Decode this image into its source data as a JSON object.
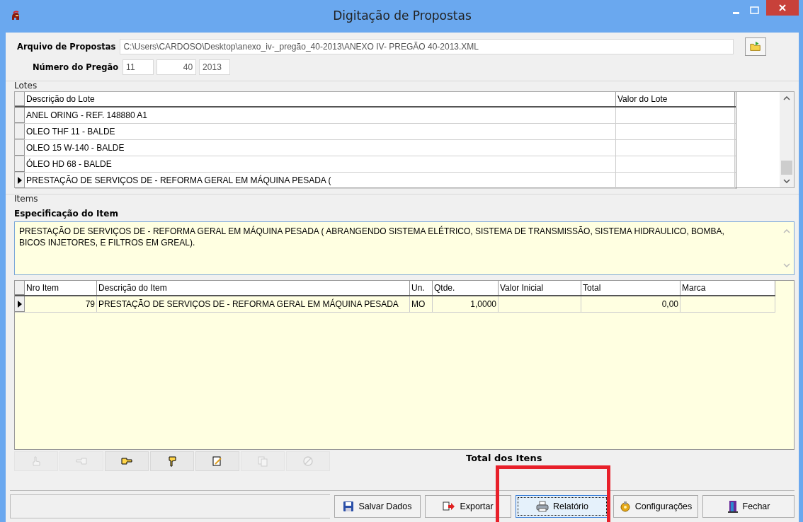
{
  "window": {
    "title": "Digitação de Propostas"
  },
  "file": {
    "label": "Arquivo de Propostas",
    "value": "C:\\Users\\CARDOSO\\Desktop\\anexo_iv-_pregão_40-2013\\ANEXO IV- PREGÃO 40-2013.XML"
  },
  "pregao": {
    "label": "Número do Pregão",
    "values": [
      "11",
      "40",
      "2013"
    ]
  },
  "lotes": {
    "title": "Lotes",
    "columns": [
      "Descrição do Lote",
      "Valor do Lote"
    ],
    "rows": [
      {
        "descricao": "ANEL ORING - REF. 148880 A1",
        "selected": false
      },
      {
        "descricao": "OLEO THF 11 - BALDE",
        "selected": false
      },
      {
        "descricao": "OLEO 15 W-140 - BALDE",
        "selected": false
      },
      {
        "descricao": "ÓLEO HD 68 - BALDE",
        "selected": false
      },
      {
        "descricao": "PRESTAÇÃO DE SERVIÇOS DE - REFORMA GERAL EM MÁQUINA PESADA (",
        "selected": true
      }
    ]
  },
  "items": {
    "title": "Items",
    "spec_label": "Especificação do Item",
    "spec_text": "PRESTAÇÃO DE SERVIÇOS DE - REFORMA GERAL EM MÁQUINA PESADA ( ABRANGENDO SISTEMA ELÉTRICO, SISTEMA DE TRANSMISSÃO, SISTEMA HIDRAULICO, BOMBA, BICOS INJETORES, E FILTROS EM GREAL).",
    "columns": [
      "Nro Item",
      "Descrição do Item",
      "Un.",
      "Qtde.",
      "Valor Inicial",
      "Total",
      "Marca"
    ],
    "rows": [
      {
        "nro": "79",
        "descricao": "PRESTAÇÃO DE SERVIÇOS DE - REFORMA GERAL EM MÁQUINA PESADA",
        "un": "MO",
        "qtde": "1,0000",
        "total": "0,00",
        "selected": true
      }
    ]
  },
  "nav_buttons": [
    {
      "kind": "up",
      "disabled": true
    },
    {
      "kind": "left",
      "disabled": true
    },
    {
      "kind": "right",
      "disabled": false
    },
    {
      "kind": "down",
      "disabled": false
    },
    {
      "kind": "edit",
      "disabled": false
    },
    {
      "kind": "copy",
      "disabled": true
    },
    {
      "kind": "cancel",
      "disabled": true
    }
  ],
  "total_label": "Total dos Itens",
  "actions": [
    {
      "kind": "save",
      "label": "Salvar Dados",
      "focused": false
    },
    {
      "kind": "export",
      "label": "Exportar",
      "focused": false
    },
    {
      "kind": "print",
      "label": "Relatório",
      "focused": true
    },
    {
      "kind": "config",
      "label": "Configurações",
      "focused": false
    },
    {
      "kind": "close",
      "label": "Fechar",
      "focused": false
    }
  ]
}
